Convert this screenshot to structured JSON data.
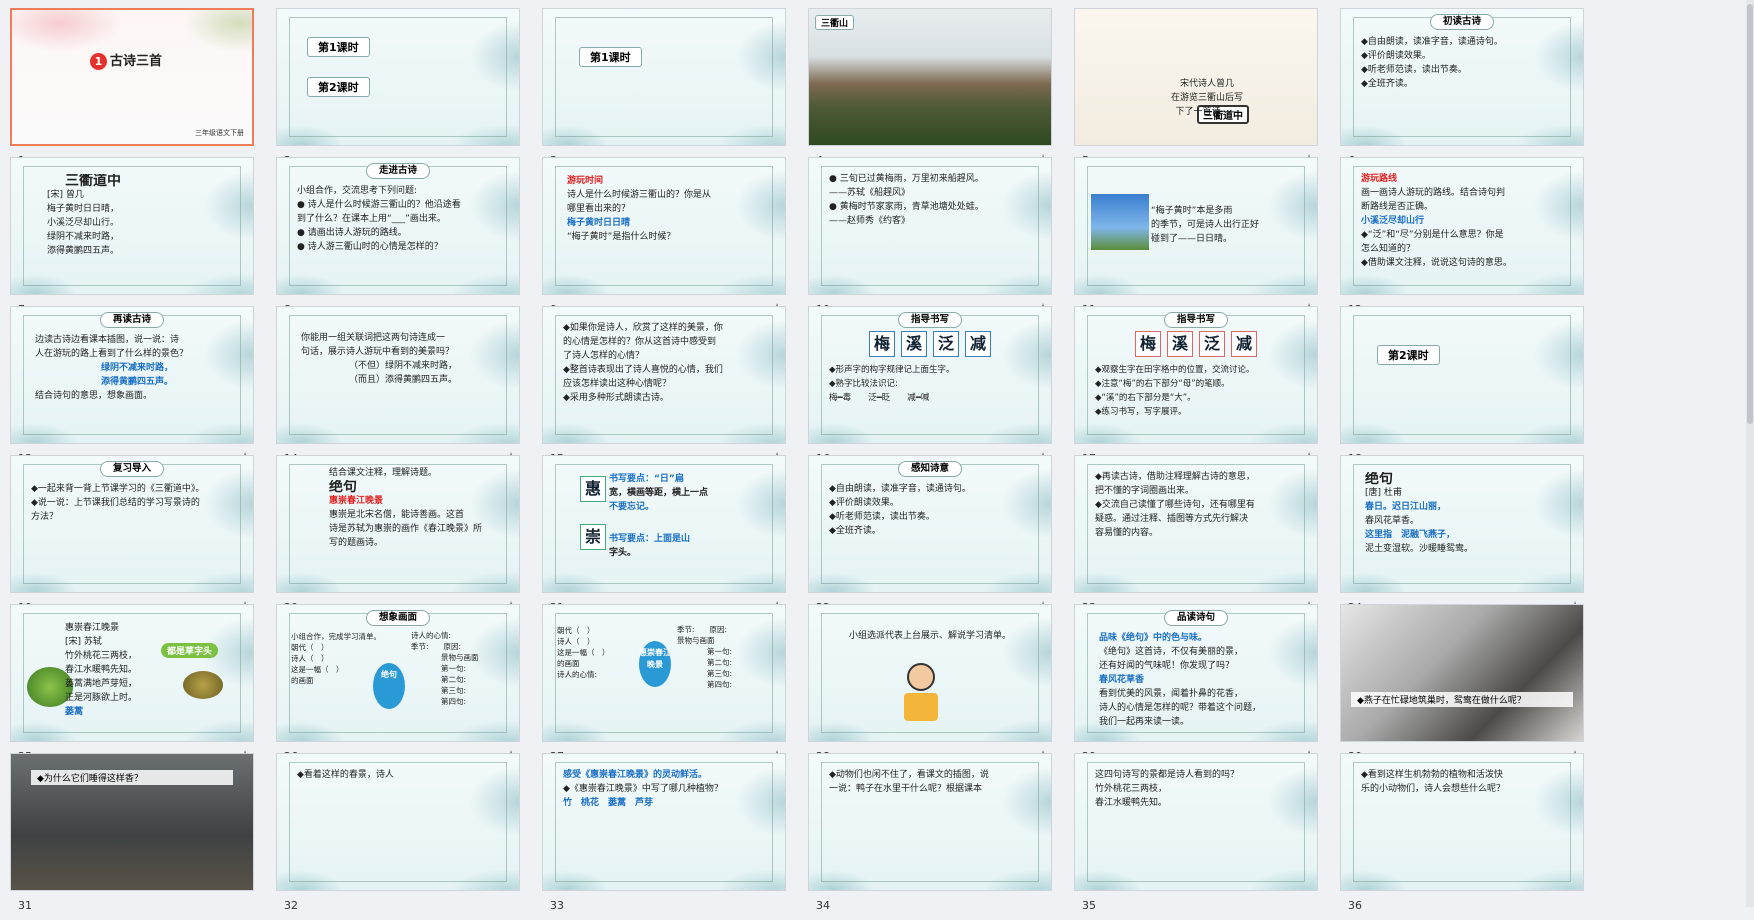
{
  "slides": [
    {
      "num": "1",
      "starred": false,
      "bg": "pink",
      "lines": [
        "古诗三首"
      ],
      "badge": "1",
      "footer": "三年级语文下册"
    },
    {
      "num": "2",
      "starred": false,
      "bg": "ink",
      "tags": [
        "第1课时",
        "第2课时"
      ]
    },
    {
      "num": "3",
      "starred": false,
      "bg": "ink",
      "tags": [
        "第1课时"
      ]
    },
    {
      "num": "4",
      "starred": true,
      "bg": "photo1",
      "tags": [
        "三衢山"
      ]
    },
    {
      "num": "5",
      "starred": true,
      "bg": "paper",
      "lines": [
        "宋代诗人曾几",
        "在游览三衢山后写",
        "下了一首诗——"
      ],
      "tags": [
        "三衢道中"
      ]
    },
    {
      "num": "6",
      "starred": false,
      "bg": "ink",
      "title": "初读古诗",
      "lines": [
        "◆自由朗读，读准字音，读通诗句。",
        "◆评价朗读效果。",
        "◆听老师范读，读出节奏。",
        "◆全班齐读。"
      ]
    },
    {
      "num": "7",
      "starred": false,
      "bg": "ink",
      "lines": [
        "三衢道中",
        "[宋] 曾几",
        "梅子黄时日日晴，",
        "小溪泛尽却山行。",
        "绿阴不减来时路，",
        "添得黄鹂四五声。"
      ]
    },
    {
      "num": "8",
      "starred": false,
      "bg": "ink",
      "title": "走进古诗",
      "lines": [
        "小组合作，交流思考下列问题:",
        "● 诗人是什么时候游三衢山的？他沿途看",
        "  到了什么？在课本上用“___”画出来。",
        "● 请画出诗人游玩的路线。",
        "● 诗人游三衢山时的心情是怎样的？"
      ]
    },
    {
      "num": "9",
      "starred": true,
      "bg": "ink",
      "lines": [
        "游玩时间",
        "诗人是什么时候游三衢山的？你是从",
        "哪里看出来的？",
        "梅子黄时日日晴",
        "“梅子黄时”是指什么时候？"
      ]
    },
    {
      "num": "10",
      "starred": true,
      "bg": "ink",
      "lines": [
        "● 三旬已过黄梅雨，万里初来船趕风。",
        "——苏轼《船趕风》",
        "● 黄梅时节家家雨，青草池塘处处蛙。",
        "——赵师秀《约客》"
      ]
    },
    {
      "num": "11",
      "starred": true,
      "bg": "ink",
      "lines": [
        "“梅子黄时”本是多雨",
        "的季节，可是诗人出行正好",
        "碰到了——日日晴。"
      ]
    },
    {
      "num": "12",
      "starred": false,
      "bg": "ink",
      "lines": [
        "游玩路线",
        "画一画诗人游玩的路线。结合诗句判",
        "断路线是否正确。",
        "小溪泛尽却山行",
        "◆“泛”和“尽”分别是什么意思？你是",
        "怎么知道的？",
        "◆借助课文注释，说说这句诗的意思。"
      ]
    },
    {
      "num": "13",
      "starred": true,
      "bg": "ink",
      "title": "再读古诗",
      "lines": [
        "边读古诗边看课本插图，说一说：诗",
        "人在游玩的路上看到了什么样的景色？",
        "绿阴不减来时路，",
        "添得黄鹂四五声。",
        "结合诗句的意思，想象画面。"
      ]
    },
    {
      "num": "14",
      "starred": true,
      "bg": "ink",
      "lines": [
        "你能用一组关联词把这两句诗连成一",
        "句话，展示诗人游玩中看到的美景吗？",
        "（不但）绿阴不减来时路，",
        "（而且）添得黄鹂四五声。"
      ]
    },
    {
      "num": "15",
      "starred": true,
      "bg": "ink",
      "lines": [
        "◆如果你是诗人，欣赏了这样的美景，你",
        "的心情是怎样的？你从这首诗中感受到",
        "了诗人怎样的心情？",
        "◆整首诗表现出了诗人喜悦的心情，我们",
        "应该怎样读出这种心情呢？",
        "◆采用多种形式朗读古诗。"
      ]
    },
    {
      "num": "16",
      "starred": true,
      "bg": "ink",
      "title": "指导书写",
      "chars": [
        "梅",
        "溪",
        "泛",
        "减"
      ],
      "lines": [
        "◆形声字的构字规律记上面生字。",
        "◆熟字比较法识记:",
        "梅━毒　　泛━眨　　减━喊"
      ]
    },
    {
      "num": "17",
      "starred": true,
      "bg": "ink",
      "title": "指导书写",
      "chars": [
        "梅",
        "溪",
        "泛",
        "减"
      ],
      "lines": [
        "◆观察生字在田字格中的位置，交流讨论。",
        "◆注意“梅”的右下部分“母”的笔顺。",
        "◆“溪”的右下部分是“大”。",
        "◆练习书写，写字展评。"
      ]
    },
    {
      "num": "18",
      "starred": false,
      "bg": "ink",
      "tags": [
        "第2课时"
      ]
    },
    {
      "num": "19",
      "starred": true,
      "bg": "ink",
      "title": "复习导入",
      "lines": [
        "◆一起来背一背上节课学习的《三衢道中》。",
        "◆说一说：上节课我们总结的学习写景诗的",
        "方法？"
      ]
    },
    {
      "num": "20",
      "starred": true,
      "bg": "ink",
      "lines": [
        "结合课文注释，理解诗题。",
        "绝句",
        "惠崇春江晚景",
        "惠崇是北宋名僧，能诗善画。这首",
        "诗是苏轼为惠崇的画作《春江晚景》所",
        "写的题画诗。"
      ]
    },
    {
      "num": "21",
      "starred": true,
      "bg": "ink",
      "chars": [
        "惠",
        "崇"
      ],
      "lines": [
        "书写要点：“日”扁",
        "宽，横画等距，横上一点",
        "不要忘记。",
        "书写要点：上面是山",
        "字头。"
      ]
    },
    {
      "num": "22",
      "starred": true,
      "bg": "ink",
      "title": "感知诗意",
      "lines": [
        "◆自由朗读，读准字音，读通诗句。",
        "◆评价朗读效果。",
        "◆听老师范读，读出节奏。",
        "◆全班齐读。"
      ]
    },
    {
      "num": "23",
      "starred": true,
      "bg": "ink",
      "lines": [
        "◆再读古诗，借助注释理解古诗的意思，",
        "把不懂的字词圈画出来。",
        "◆交流自己读懂了哪些诗句，还有哪里有",
        "疑惑。通过注释、插图等方式先行解决",
        "容易懂的内容。"
      ]
    },
    {
      "num": "24",
      "starred": true,
      "bg": "ink",
      "lines": [
        "绝句",
        "[唐] 杜甫",
        "春日。迟日江山丽，",
        "春风花草香。",
        "这里指　泥融飞燕子，",
        "泥土变湿软。沙暖睡鸳鸯。"
      ]
    },
    {
      "num": "25",
      "starred": true,
      "bg": "ink",
      "lines": [
        "惠崇春江晚景",
        "[宋] 苏轼",
        "竹外桃花三两枝，",
        "春江水暖鸭先知。",
        "蒌蒿满地芦芽短，",
        "正是河豚欲上时。",
        "蒌蒿"
      ],
      "bubble": "都是草字头"
    },
    {
      "num": "26",
      "starred": true,
      "bg": "ink",
      "title": "想象画面",
      "lines": [
        "小组合作，完成学习清单。",
        "朝代（　）",
        "诗人（　）",
        "这是一幅（　）",
        "的画面",
        "诗人的心情:",
        "季节:　　原因:",
        "景物与画面",
        "第一句:",
        "第二句:",
        "第三句:",
        "第四句:"
      ],
      "center": "绝句"
    },
    {
      "num": "27",
      "starred": true,
      "bg": "ink",
      "lines": [
        "朝代（　）",
        "诗人（　）",
        "这是一幅（　）",
        "的画面",
        "诗人的心情:",
        "季节:　　原因:",
        "景物与画面",
        "第一句:",
        "第二句:",
        "第三句:",
        "第四句:"
      ],
      "center": "惠崇春江晚景"
    },
    {
      "num": "28",
      "starred": true,
      "bg": "ink",
      "lines": [
        "小组选派代表上台展示、解说学习清单。"
      ]
    },
    {
      "num": "29",
      "starred": true,
      "bg": "ink",
      "title": "品读诗句",
      "lines": [
        "品味《绝句》中的色与味。",
        "《绝句》这首诗，不仅有美丽的景，",
        "还有好闻的气味呢！你发现了吗？",
        "春风花草香",
        "看到优美的风景，闻着扑鼻的花香，",
        "诗人的心情是怎样的呢？带着这个问题，",
        "我们一起再来读一读。"
      ]
    },
    {
      "num": "30",
      "starred": true,
      "bg": "photo2",
      "caption": "◆燕子在忙碌地筑巢时，鸳鸯在做什么呢？"
    },
    {
      "num": "31",
      "starred": false,
      "bg": "photo3",
      "caption": "◆为什么它们睡得这样香？"
    },
    {
      "num": "32",
      "starred": false,
      "bg": "ink",
      "lines": [
        "◆看着这样的春景，诗人"
      ]
    },
    {
      "num": "33",
      "starred": false,
      "bg": "ink",
      "lines": [
        "感受《惠崇春江晚景》的灵动鲜活。",
        "◆《惠崇春江晚景》中写了哪几种植物？",
        "竹　桃花　蒌蒿　芦芽"
      ]
    },
    {
      "num": "34",
      "starred": false,
      "bg": "ink",
      "lines": [
        "◆动物们也闲不住了，看课文的插图，说",
        "一说：鸭子在水里干什么呢？根据课本"
      ]
    },
    {
      "num": "35",
      "starred": false,
      "bg": "ink",
      "lines": [
        "这四句诗写的景都是诗人看到的吗？",
        "竹外桃花三两枝，",
        "春江水暖鸭先知。"
      ]
    },
    {
      "num": "36",
      "starred": false,
      "bg": "ink",
      "lines": [
        "◆看到这样生机勃勃的植物和活泼快",
        "乐的小动物们，诗人会想些什么呢？"
      ]
    }
  ]
}
